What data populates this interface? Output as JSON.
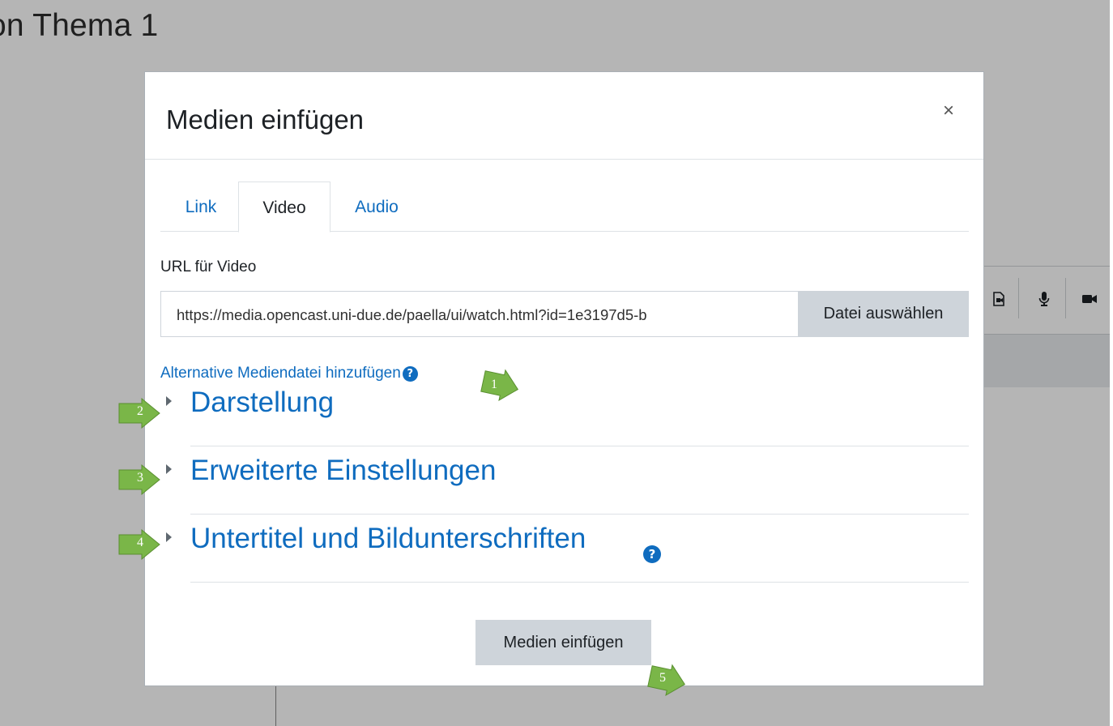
{
  "page": {
    "heading": "on Thema 1",
    "toolbar_icons": [
      "video-file-icon",
      "microphone-icon",
      "camera-icon"
    ]
  },
  "modal": {
    "title": "Medien einfügen",
    "close_label": "×",
    "tabs": [
      {
        "label": "Link",
        "active": false
      },
      {
        "label": "Video",
        "active": true
      },
      {
        "label": "Audio",
        "active": false
      }
    ],
    "url_label": "URL für Video",
    "url_value": "https://media.opencast.uni-due.de/paella/ui/watch.html?id=1e3197d5-b",
    "file_button": "Datei auswählen",
    "alt_link": "Alternative Mediendatei hinzufügen",
    "help_glyph": "?",
    "sections": [
      {
        "title": "Darstellung",
        "has_help": false
      },
      {
        "title": "Erweiterte Einstellungen",
        "has_help": false
      },
      {
        "title": "Untertitel und Bildunterschriften",
        "has_help": true
      }
    ],
    "insert_button": "Medien einfügen"
  },
  "markers": [
    "1",
    "2",
    "3",
    "4",
    "5"
  ],
  "colors": {
    "link": "#0f6cbf",
    "marker_green": "#7ab648",
    "button_grey": "#ced4da"
  }
}
